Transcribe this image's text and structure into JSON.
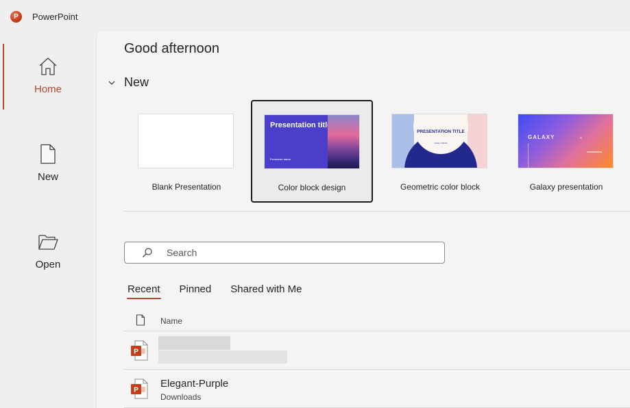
{
  "app": {
    "title": "PowerPoint",
    "logo_letter": "P",
    "accent_color": "#b7472a"
  },
  "sidebar": {
    "items": [
      {
        "label": "Home",
        "icon": "home-icon",
        "active": true
      },
      {
        "label": "New",
        "icon": "new-file-icon",
        "active": false
      },
      {
        "label": "Open",
        "icon": "folder-open-icon",
        "active": false
      }
    ]
  },
  "main": {
    "greeting": "Good afternoon",
    "new_section": {
      "title": "New",
      "expanded": true,
      "templates": [
        {
          "label": "Blank Presentation",
          "selected": false
        },
        {
          "label": "Color block design",
          "selected": true,
          "thumb_title": "Presentation title",
          "thumb_sub": "Presenter name"
        },
        {
          "label": "Geometric color block",
          "selected": false,
          "thumb_title": "PRESENTATION TITLE",
          "thumb_sub": "A Day / Month"
        },
        {
          "label": "Galaxy presentation",
          "selected": false,
          "thumb_title": "GALAXY"
        }
      ]
    },
    "search": {
      "placeholder": "Search",
      "value": ""
    },
    "tabs": [
      {
        "label": "Recent",
        "active": true
      },
      {
        "label": "Pinned",
        "active": false
      },
      {
        "label": "Shared with Me",
        "active": false
      }
    ],
    "file_list": {
      "column_name": "Name",
      "files": [
        {
          "name": "",
          "location": "",
          "redacted": true
        },
        {
          "name": "Elegant-Purple",
          "location": "Downloads",
          "redacted": false
        }
      ]
    }
  }
}
